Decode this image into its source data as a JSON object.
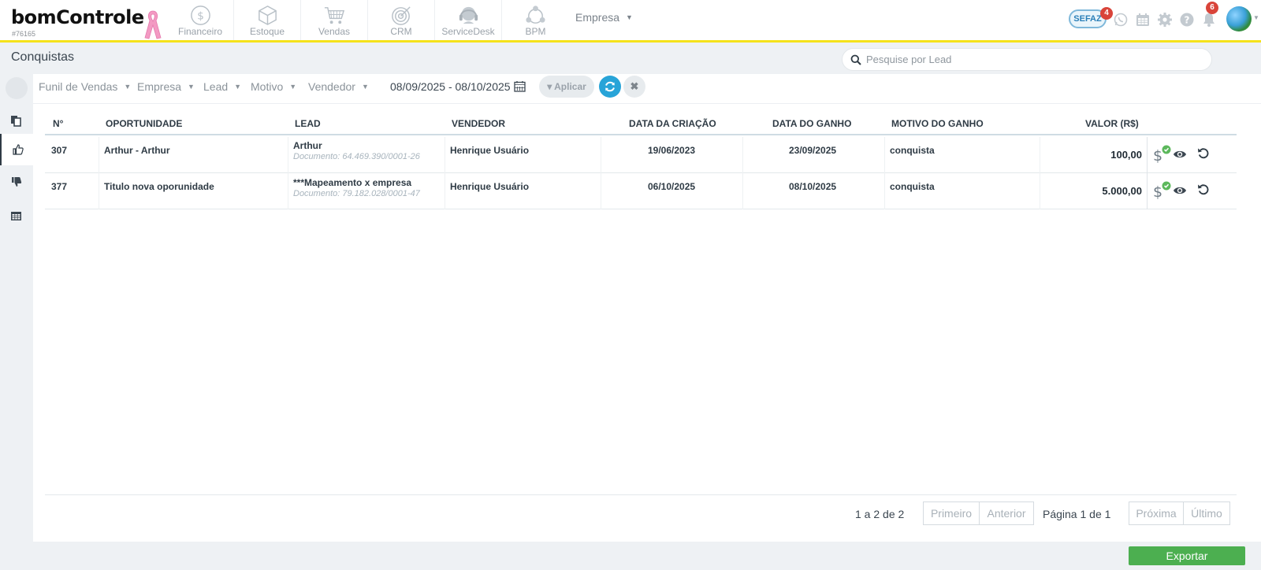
{
  "app": {
    "logo_text": "bomControle",
    "account_id": "#76165",
    "modules": [
      {
        "label": "Financeiro",
        "icon": "dollar-circle-icon"
      },
      {
        "label": "Estoque",
        "icon": "box-icon"
      },
      {
        "label": "Vendas",
        "icon": "cart-icon"
      },
      {
        "label": "CRM",
        "icon": "target-icon"
      },
      {
        "label": "ServiceDesk",
        "icon": "headset-icon"
      },
      {
        "label": "BPM",
        "icon": "process-icon"
      }
    ],
    "empresa_label": "Empresa",
    "sefaz_label": "SEFAZ",
    "sefaz_badge": "4",
    "notifications_badge": "6"
  },
  "page": {
    "title": "Conquistas",
    "search_placeholder": "Pesquise por Lead"
  },
  "filters": {
    "funil": "Funil de Vendas",
    "empresa": "Empresa",
    "lead": "Lead",
    "motivo": "Motivo",
    "vendedor": "Vendedor",
    "date_range": "08/09/2025 - 08/10/2025",
    "apply_label": "Aplicar"
  },
  "table": {
    "headers": {
      "numero": "N°",
      "oportunidade": "OPORTUNIDADE",
      "lead": "LEAD",
      "vendedor": "VENDEDOR",
      "data_criacao": "DATA DA CRIAÇÃO",
      "data_ganho": "DATA DO GANHO",
      "motivo": "MOTIVO DO GANHO",
      "valor": "VALOR (R$)"
    },
    "rows": [
      {
        "numero": "307",
        "oportunidade": "Arthur - Arthur",
        "lead": "Arthur",
        "documento": "Documento: 64.469.390/0001-26",
        "vendedor": "Henrique Usuário",
        "data_criacao": "19/06/2023",
        "data_ganho": "23/09/2025",
        "motivo": "conquista",
        "valor": "100,00"
      },
      {
        "numero": "377",
        "oportunidade": "Titulo nova oporunidade",
        "lead": "***Mapeamento x empresa",
        "documento": "Documento: 79.182.028/0001-47",
        "vendedor": "Henrique Usuário",
        "data_criacao": "06/10/2025",
        "data_ganho": "08/10/2025",
        "motivo": "conquista",
        "valor": "5.000,00"
      }
    ]
  },
  "pagination": {
    "count": "1 a 2 de 2",
    "first": "Primeiro",
    "previous": "Anterior",
    "page_prefix": "Página",
    "page_current": "1",
    "page_of": "de",
    "page_total": "1",
    "next": "Próxima",
    "last": "Último"
  },
  "export_label": "Exportar",
  "colors": {
    "accent_yellow": "#f5e21b",
    "refresh_blue": "#28a4d8",
    "export_green": "#4caf50",
    "badge_red": "#d9443a"
  }
}
